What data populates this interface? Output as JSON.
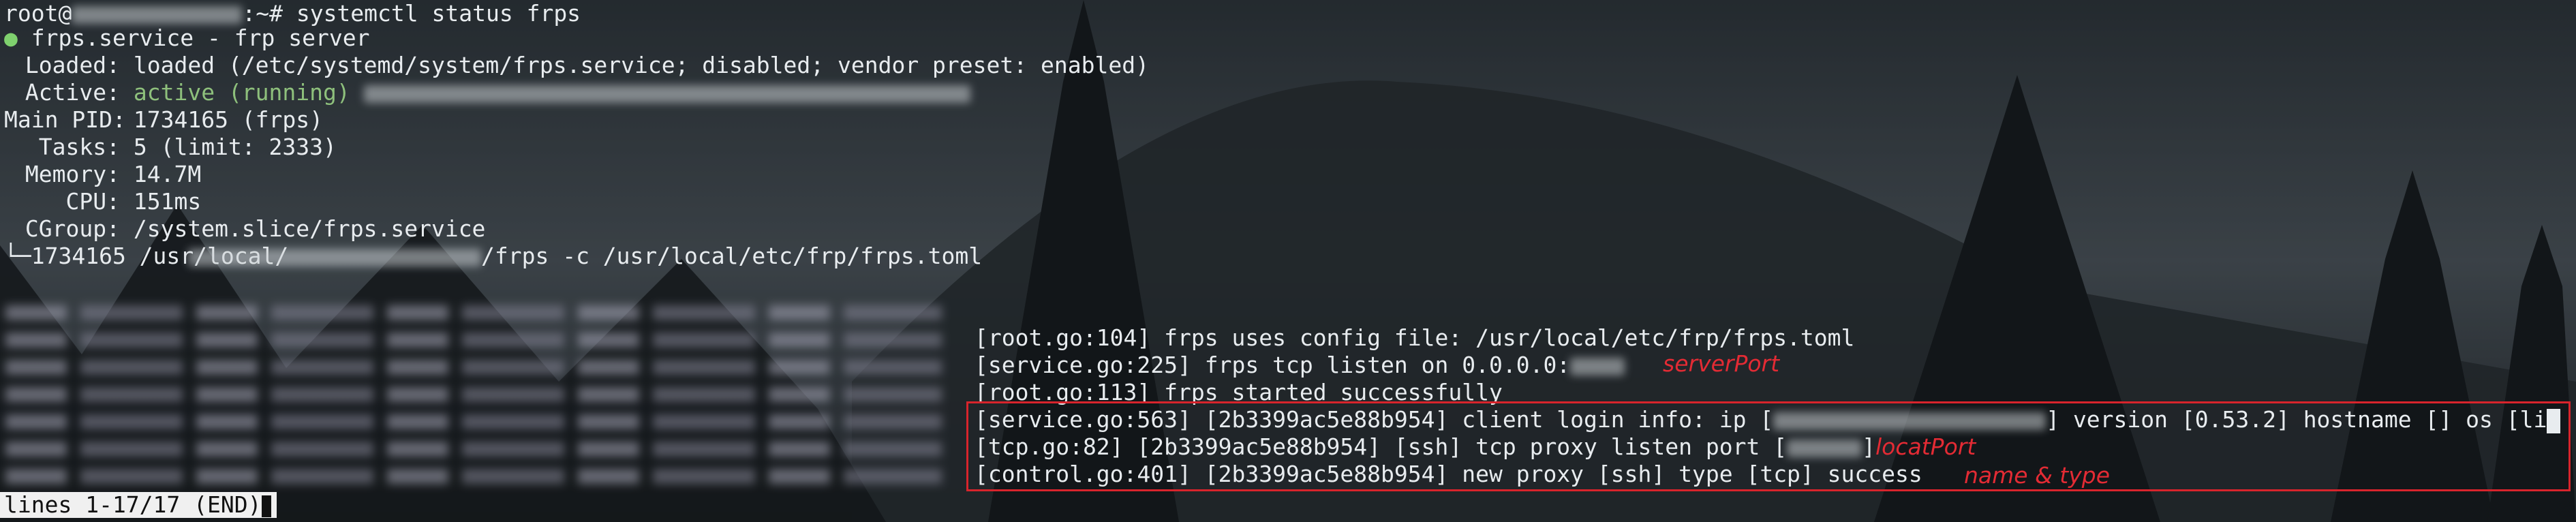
{
  "prompt": {
    "user": "root@",
    "suffix": ":~# ",
    "command": "systemctl status frps"
  },
  "unit": {
    "bullet": "●",
    "title": " frps.service - frp server"
  },
  "fields": {
    "loaded_label": "Loaded:",
    "loaded_value": " loaded (/etc/systemd/system/frps.service; disabled; vendor preset: enabled)",
    "active_label": "Active:",
    "active_value": " active (running)",
    "pid_label": "Main PID:",
    "pid_value": " 1734165 (frps)",
    "tasks_label": "Tasks:",
    "tasks_value": " 5 (limit: 2333)",
    "memory_label": "Memory:",
    "memory_value": " 14.7M",
    "cpu_label": "CPU:",
    "cpu_value": " 151ms",
    "cgroup_label": "CGroup:",
    "cgroup_value": " /system.slice/frps.service",
    "cgroup_child_prefix": "└─1734165 /usr/local/",
    "cgroup_child_suffix": "/frps -c /usr/local/etc/frp/frps.toml"
  },
  "log": {
    "l1": "[root.go:104] frps uses config file: /usr/local/etc/frp/frps.toml",
    "l2": "[service.go:225] frps tcp listen on 0.0.0.0:",
    "l3": "[root.go:113] frps started successfully",
    "l4a": "[service.go:563] [2b3399ac5e88b954] client login info: ip [",
    "l4b": "] version [0.53.2] hostname [] os [li",
    "l5a": "[tcp.go:82] [2b3399ac5e88b954] [ssh] tcp proxy listen port [",
    "l5b": "]",
    "l6": "[control.go:401] [2b3399ac5e88b954] new proxy [ssh] type [tcp] success"
  },
  "annotations": {
    "server_port": "serverPort",
    "local_port": "locatPort",
    "name_type": "name & type"
  },
  "pager": {
    "status": "lines 1-17/17 (END)"
  }
}
